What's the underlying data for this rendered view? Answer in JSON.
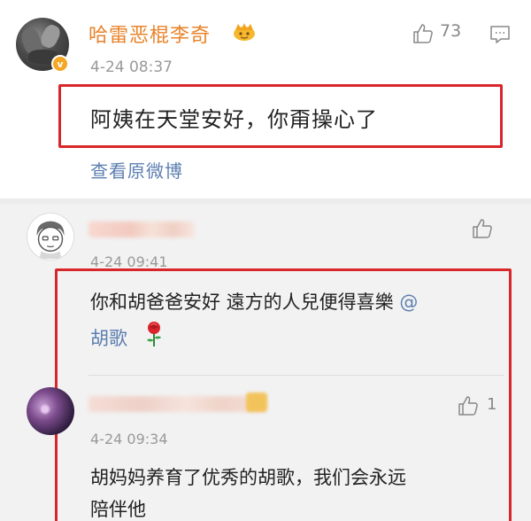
{
  "main_comment": {
    "username": "哈雷恶棍李奇",
    "badge_icon": "crown-emoji-icon",
    "timestamp": "4-24 08:37",
    "likes": "73",
    "text": "阿姨在天堂安好，你甭操心了",
    "view_original": "查看原微博"
  },
  "replies": [
    {
      "timestamp": "4-24 09:41",
      "text_line1": "你和胡爸爸安好 遠方的人兒便得喜樂 ",
      "mention_at": "@",
      "mention_name": "胡歌",
      "emoji": "rose-icon"
    },
    {
      "timestamp": "4-24 09:34",
      "likes": "1",
      "text_line1": "胡妈妈养育了优秀的胡歌，我们会永远",
      "text_line2": "陪伴他"
    }
  ],
  "colors": {
    "username": "#e8832a",
    "link": "#5d7fb0",
    "highlight_box": "#d9262a",
    "timestamp": "#999999"
  }
}
